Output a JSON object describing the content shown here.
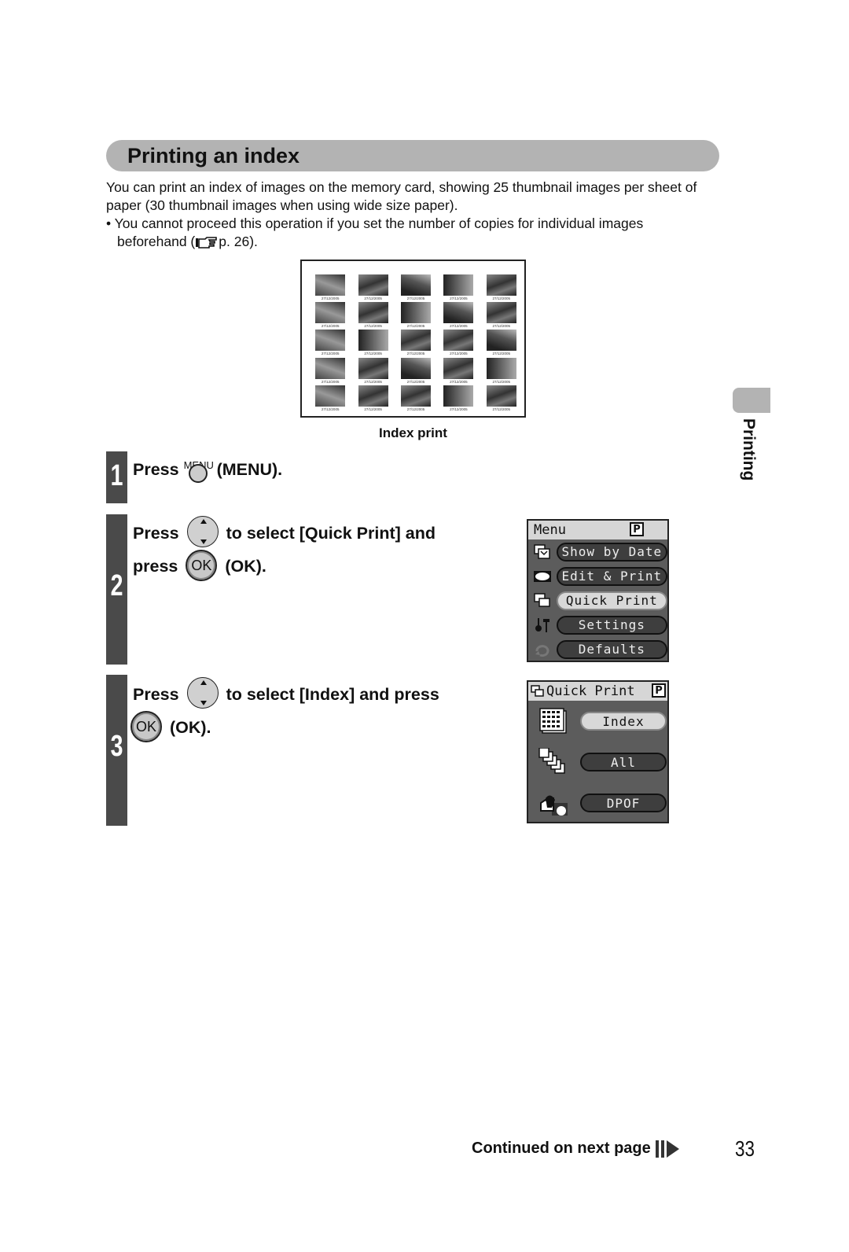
{
  "section": {
    "title": "Printing an index"
  },
  "intro": {
    "paragraph": "You can print an index of images on the memory card, showing 25 thumbnail images per sheet of paper (30 thumbnail images when using wide size paper).",
    "bullet_prefix": "• You cannot proceed this operation if you set the number of copies for individual images beforehand (",
    "bullet_ref": "p. 26",
    "bullet_suffix": ")."
  },
  "index_figure": {
    "caption": "Index print",
    "thumbnail_count": 25,
    "thumbnail_dates": [
      "27/12/2005",
      "27/12/2005",
      "27/12/2005",
      "27/12/2005",
      "27/12/2005",
      "27/12/2005",
      "27/12/2005",
      "27/12/2005",
      "27/12/2005",
      "27/12/2005",
      "27/12/2005",
      "27/12/2005",
      "27/12/2005",
      "27/12/2005",
      "27/12/2005",
      "27/12/2005",
      "27/12/2005",
      "27/12/2005",
      "27/12/2005",
      "27/12/2005",
      "27/12/2005",
      "27/12/2005",
      "27/12/2005",
      "27/12/2005",
      "27/12/2005"
    ]
  },
  "steps": [
    {
      "number": "1",
      "press": "Press",
      "button_label": "MENU",
      "after": "(MENU)."
    },
    {
      "number": "2",
      "press": "Press",
      "line1_after": "to select [Quick Print] and",
      "line2_before": "press",
      "ok_label": "OK",
      "line2_after": "(OK)."
    },
    {
      "number": "3",
      "press": "Press",
      "line1_after": "to select [Index] and press",
      "ok_label": "OK",
      "line2_after": "(OK)."
    }
  ],
  "menu_screen": {
    "title": "Menu",
    "mode_badge": "P",
    "items": [
      {
        "label": "Show by Date",
        "icon": "calendar-stack-icon",
        "selected": false
      },
      {
        "label": "Edit & Print",
        "icon": "edit-oval-icon",
        "selected": false
      },
      {
        "label": "Quick Print",
        "icon": "stack-icon",
        "selected": true
      },
      {
        "label": "Settings",
        "icon": "tools-icon",
        "selected": false
      },
      {
        "label": "Defaults",
        "icon": "reset-icon",
        "selected": false
      }
    ]
  },
  "quick_print_screen": {
    "title": "Quick Print",
    "mode_badge": "P",
    "items": [
      {
        "label": "Index",
        "icon": "index-grid-icon",
        "selected": true
      },
      {
        "label": "All",
        "icon": "multi-page-icon",
        "selected": false
      },
      {
        "label": "DPOF",
        "icon": "dpof-icon",
        "selected": false
      }
    ]
  },
  "side_tab": {
    "label": "Printing"
  },
  "footer": {
    "continued": "Continued on next page",
    "page_number": "33"
  }
}
